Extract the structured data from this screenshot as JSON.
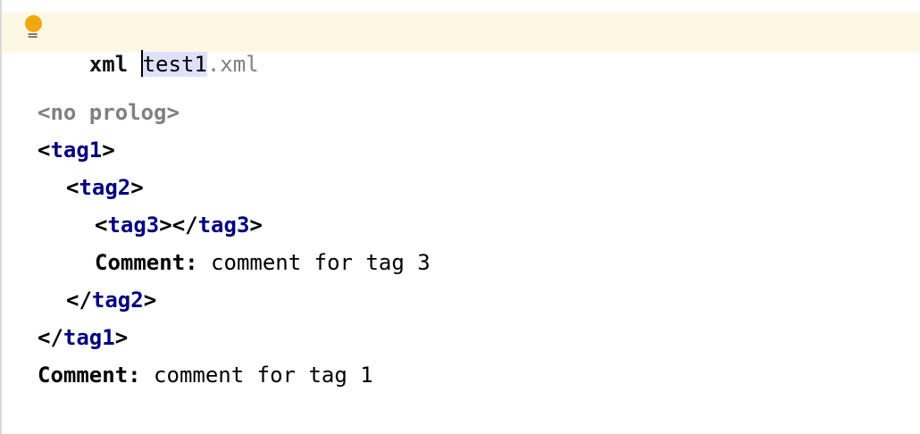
{
  "header": {
    "keyword": "xml",
    "selected_text": "test1",
    "extension": ".xml"
  },
  "lines": {
    "prolog": "<no prolog>",
    "open_tag1": "tag1",
    "open_tag2": "tag2",
    "open_tag3": "tag3",
    "close_tag3": "tag3",
    "comment3_label": "Comment:",
    "comment3_text": "comment for tag 3",
    "close_tag2": "tag2",
    "close_tag1": "tag1",
    "comment1_label": "Comment:",
    "comment1_text": "comment for tag 1"
  },
  "icons": {
    "intention_bulb": "lightbulb-icon",
    "gutter_marker": "equals-icon"
  },
  "colors": {
    "current_line_bg": "#fdf8e3",
    "selection_bg": "#dfe1fc",
    "tag_name": "#000080",
    "bulb": "#f2a80c",
    "grey_text": "#808080"
  }
}
